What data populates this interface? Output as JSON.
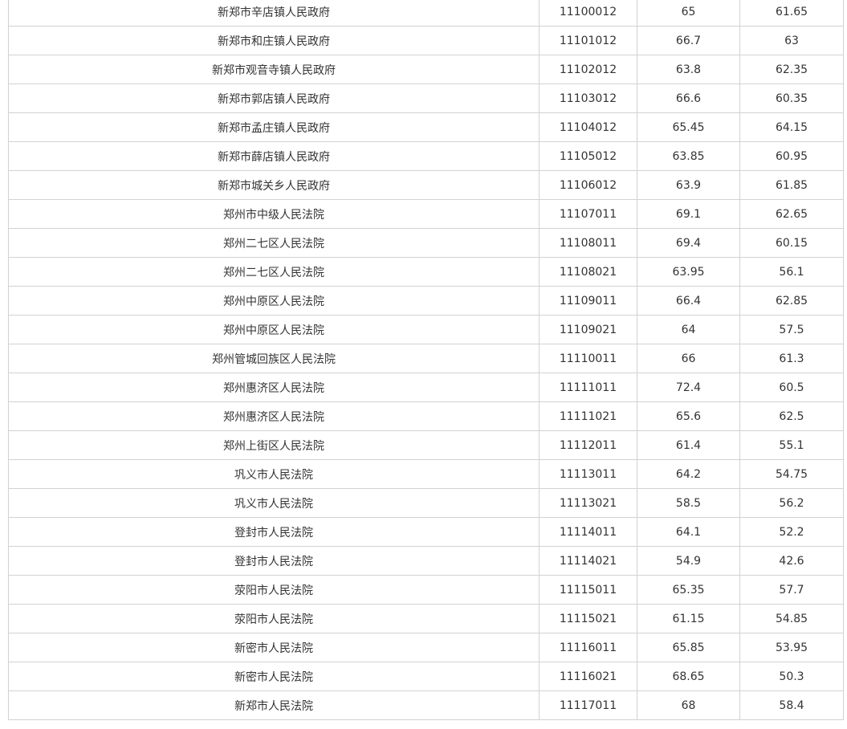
{
  "table": {
    "rows": [
      {
        "name": "新郑市辛店镇人民政府",
        "code": "11100012",
        "score1": "65",
        "score2": "61.65"
      },
      {
        "name": "新郑市和庄镇人民政府",
        "code": "11101012",
        "score1": "66.7",
        "score2": "63"
      },
      {
        "name": "新郑市观音寺镇人民政府",
        "code": "11102012",
        "score1": "63.8",
        "score2": "62.35"
      },
      {
        "name": "新郑市郭店镇人民政府",
        "code": "11103012",
        "score1": "66.6",
        "score2": "60.35"
      },
      {
        "name": "新郑市孟庄镇人民政府",
        "code": "11104012",
        "score1": "65.45",
        "score2": "64.15"
      },
      {
        "name": "新郑市薛店镇人民政府",
        "code": "11105012",
        "score1": "63.85",
        "score2": "60.95"
      },
      {
        "name": "新郑市城关乡人民政府",
        "code": "11106012",
        "score1": "63.9",
        "score2": "61.85"
      },
      {
        "name": "郑州市中级人民法院",
        "code": "11107011",
        "score1": "69.1",
        "score2": "62.65"
      },
      {
        "name": "郑州二七区人民法院",
        "code": "11108011",
        "score1": "69.4",
        "score2": "60.15"
      },
      {
        "name": "郑州二七区人民法院",
        "code": "11108021",
        "score1": "63.95",
        "score2": "56.1"
      },
      {
        "name": "郑州中原区人民法院",
        "code": "11109011",
        "score1": "66.4",
        "score2": "62.85"
      },
      {
        "name": "郑州中原区人民法院",
        "code": "11109021",
        "score1": "64",
        "score2": "57.5"
      },
      {
        "name": "郑州管城回族区人民法院",
        "code": "11110011",
        "score1": "66",
        "score2": "61.3"
      },
      {
        "name": "郑州惠济区人民法院",
        "code": "11111011",
        "score1": "72.4",
        "score2": "60.5"
      },
      {
        "name": "郑州惠济区人民法院",
        "code": "11111021",
        "score1": "65.6",
        "score2": "62.5"
      },
      {
        "name": "郑州上街区人民法院",
        "code": "11112011",
        "score1": "61.4",
        "score2": "55.1"
      },
      {
        "name": "巩义市人民法院",
        "code": "11113011",
        "score1": "64.2",
        "score2": "54.75"
      },
      {
        "name": "巩义市人民法院",
        "code": "11113021",
        "score1": "58.5",
        "score2": "56.2"
      },
      {
        "name": "登封市人民法院",
        "code": "11114011",
        "score1": "64.1",
        "score2": "52.2"
      },
      {
        "name": "登封市人民法院",
        "code": "11114021",
        "score1": "54.9",
        "score2": "42.6"
      },
      {
        "name": "荥阳市人民法院",
        "code": "11115011",
        "score1": "65.35",
        "score2": "57.7"
      },
      {
        "name": "荥阳市人民法院",
        "code": "11115021",
        "score1": "61.15",
        "score2": "54.85"
      },
      {
        "name": "新密市人民法院",
        "code": "11116011",
        "score1": "65.85",
        "score2": "53.95"
      },
      {
        "name": "新密市人民法院",
        "code": "11116021",
        "score1": "68.65",
        "score2": "50.3"
      },
      {
        "name": "新郑市人民法院",
        "code": "11117011",
        "score1": "68",
        "score2": "58.4"
      }
    ]
  }
}
